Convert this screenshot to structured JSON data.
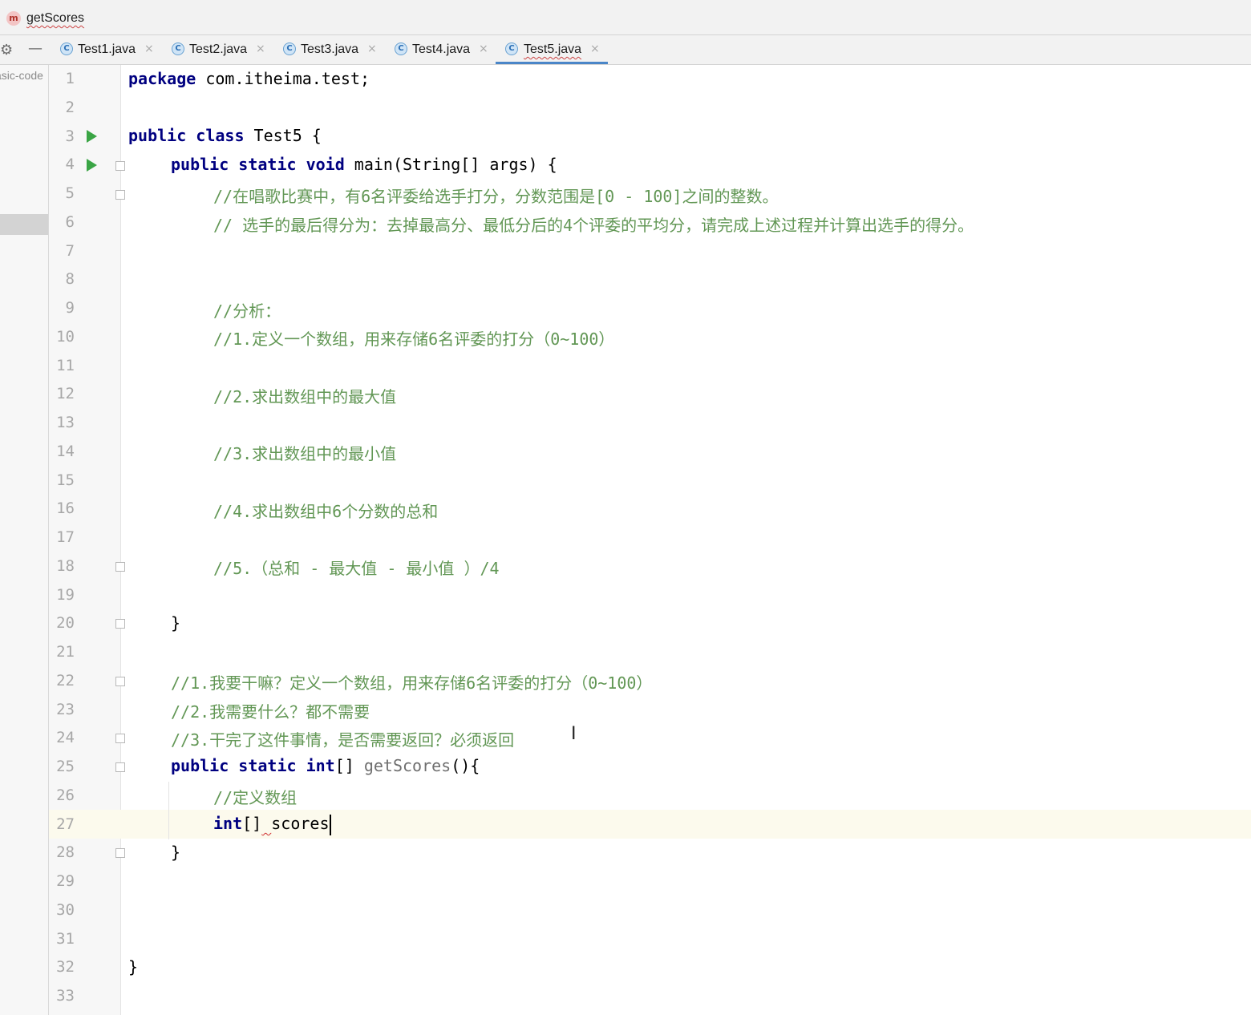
{
  "breadcrumb": {
    "icon_letter": "m",
    "method": "getScores"
  },
  "tabs": [
    {
      "label": "Test1.java",
      "icon": "C"
    },
    {
      "label": "Test2.java",
      "icon": "C"
    },
    {
      "label": "Test3.java",
      "icon": "C"
    },
    {
      "label": "Test4.java",
      "icon": "C"
    },
    {
      "label": "Test5.java",
      "icon": "C"
    }
  ],
  "active_tab": "Test5.java",
  "close_glyph": "×",
  "toolbar": {
    "gear_glyph": "⚙",
    "minimize_glyph": "—"
  },
  "project_panel": {
    "text": "asic-code"
  },
  "editor": {
    "line_numbers": [
      "1",
      "2",
      "3",
      "4",
      "5",
      "6",
      "7",
      "8",
      "9",
      "10",
      "11",
      "12",
      "13",
      "14",
      "15",
      "16",
      "17",
      "18",
      "19",
      "20",
      "21",
      "22",
      "23",
      "24",
      "25",
      "26",
      "27",
      "28",
      "29",
      "30",
      "31",
      "32",
      "33"
    ],
    "lines": {
      "l1": {
        "kw": "package",
        "rest": " com.itheima.test;"
      },
      "l3": {
        "kw": "public class",
        "rest": " Test5 {"
      },
      "l4": {
        "kw": "public static void",
        "rest": " main(String[] args) {"
      },
      "l5": "//在唱歌比赛中，有6名评委给选手打分，分数范围是[0 - 100]之间的整数。",
      "l6": "// 选手的最后得分为：去掉最高分、最低分后的4个评委的平均分，请完成上述过程并计算出选手的得分。",
      "l9": "//分析：",
      "l10": "//1.定义一个数组，用来存储6名评委的打分（0~100）",
      "l12": "//2.求出数组中的最大值",
      "l14": "//3.求出数组中的最小值",
      "l16": "//4.求出数组中6个分数的总和",
      "l18": "//5.（总和 - 最大值 - 最小值 ）/4",
      "l20": "}",
      "l22": "//1.我要干嘛？定义一个数组，用来存储6名评委的打分（0~100）",
      "l23": "//2.我需要什么？都不需要",
      "l24": "//3.干完了这件事情，是否需要返回？必须返回",
      "l25": {
        "kw1": "public static",
        "kw2": "int",
        "brk": "[] ",
        "name": "getScores",
        "rest": "(){"
      },
      "l26": "//定义数组",
      "l27": {
        "kw": "int",
        "brk": "[]",
        "sp": " ",
        "name": "scores"
      },
      "l28": "}",
      "l32": "}"
    },
    "caret_line": 27
  },
  "colors": {
    "keyword": "#000080",
    "comment": "#629755",
    "accent": "#4a86c8",
    "run": "#3aa545"
  }
}
